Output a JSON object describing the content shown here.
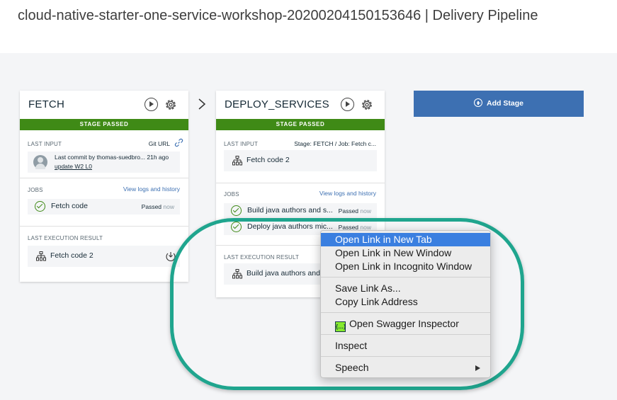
{
  "page": {
    "title": "cloud-native-starter-one-service-workshop-20200204150153646 | Delivery Pipeline"
  },
  "stages": [
    {
      "name": "FETCH",
      "status": "STAGE PASSED",
      "last_input": {
        "label": "LAST INPUT",
        "right": "Git URL",
        "commit_text": "Last commit by thomas-suedbro... 21h ago",
        "commit_link": "update W2 L0"
      },
      "jobs": {
        "label": "JOBS",
        "link": "View logs and history",
        "items": [
          {
            "name": "Fetch code",
            "status": "Passed",
            "time": "now"
          }
        ]
      },
      "last_result": {
        "label": "LAST EXECUTION RESULT",
        "value": "Fetch code 2"
      }
    },
    {
      "name": "DEPLOY_SERVICES",
      "status": "STAGE PASSED",
      "last_input": {
        "label": "LAST INPUT",
        "right": "Stage: FETCH  /  Job: Fetch c...",
        "value": "Fetch code 2"
      },
      "jobs": {
        "label": "JOBS",
        "link": "View logs and history",
        "items": [
          {
            "name": "Build java authors and s...",
            "status": "Passed",
            "time": "now"
          },
          {
            "name": "Deploy java authors mic...",
            "status": "Passed",
            "time": "now"
          }
        ]
      },
      "last_result": {
        "label": "LAST EXECUTION RESULT",
        "value": "Build java authors and"
      }
    }
  ],
  "add_stage": {
    "label": "Add Stage"
  },
  "context_menu": {
    "items": [
      "Open Link in New Tab",
      "Open Link in New Window",
      "Open Link in Incognito Window",
      "Save Link As...",
      "Copy Link Address",
      "Open Swagger Inspector",
      "Inspect",
      "Speech"
    ]
  },
  "colors": {
    "passed": "#3f8a16",
    "primary": "#3d70b2",
    "highlight": "#1fa58e",
    "menu_active": "#3a7fe0"
  }
}
